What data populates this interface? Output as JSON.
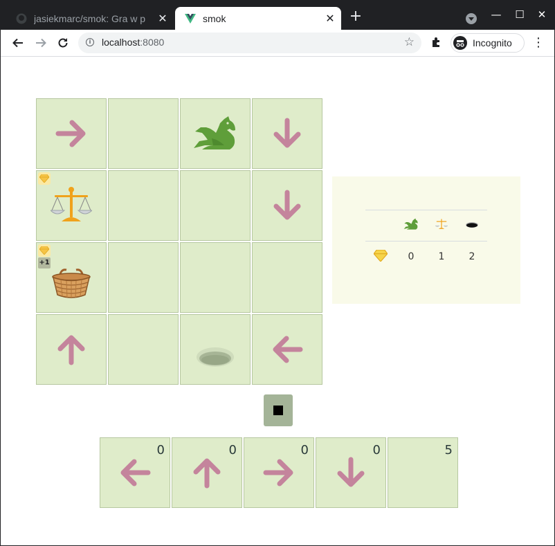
{
  "browser": {
    "tabs": [
      {
        "title": "jasiekmarc/smok: Gra w p",
        "close": "✕",
        "active": false,
        "favicon": "github-icon"
      },
      {
        "title": "smok",
        "close": "✕",
        "active": true,
        "favicon": "vue-icon"
      }
    ],
    "new_tab": "+",
    "window_buttons": {
      "minimize": "—",
      "maximize": "☐",
      "close": "✕"
    },
    "url_host": "localhost",
    "url_port": ":8080",
    "incognito_label": "Incognito",
    "menu": "⋮"
  },
  "board": {
    "cells": [
      {
        "row": 0,
        "col": 0,
        "content": "arrow-right"
      },
      {
        "row": 0,
        "col": 1,
        "content": "empty"
      },
      {
        "row": 0,
        "col": 2,
        "content": "dragon"
      },
      {
        "row": 0,
        "col": 3,
        "content": "arrow-down"
      },
      {
        "row": 1,
        "col": 0,
        "content": "scales",
        "gem": true
      },
      {
        "row": 1,
        "col": 1,
        "content": "empty"
      },
      {
        "row": 1,
        "col": 2,
        "content": "empty"
      },
      {
        "row": 1,
        "col": 3,
        "content": "arrow-down"
      },
      {
        "row": 2,
        "col": 0,
        "content": "basket",
        "gem": true,
        "bonus": "+1"
      },
      {
        "row": 2,
        "col": 1,
        "content": "empty"
      },
      {
        "row": 2,
        "col": 2,
        "content": "empty"
      },
      {
        "row": 2,
        "col": 3,
        "content": "empty"
      },
      {
        "row": 3,
        "col": 0,
        "content": "arrow-up"
      },
      {
        "row": 3,
        "col": 1,
        "content": "empty"
      },
      {
        "row": 3,
        "col": 2,
        "content": "hole"
      },
      {
        "row": 3,
        "col": 3,
        "content": "arrow-left"
      }
    ],
    "bonus_label": "+1"
  },
  "stats": {
    "columns": [
      "dragon-icon",
      "scales-icon",
      "hole-icon"
    ],
    "row_icon": "gem-icon",
    "values": [
      "0",
      "1",
      "2"
    ]
  },
  "controls": {
    "stop_icon": "stop-icon"
  },
  "palette": [
    {
      "icon": "arrow-left",
      "count": "0"
    },
    {
      "icon": "arrow-up",
      "count": "0"
    },
    {
      "icon": "arrow-right",
      "count": "0"
    },
    {
      "icon": "arrow-down",
      "count": "0"
    },
    {
      "icon": "empty",
      "count": "5"
    }
  ],
  "colors": {
    "cell_bg": "#dfecca",
    "arrow": "#c4849c",
    "dragon": "#5f9e3a",
    "stats_bg": "#f9fae9",
    "stop_button": "#a4b498"
  }
}
